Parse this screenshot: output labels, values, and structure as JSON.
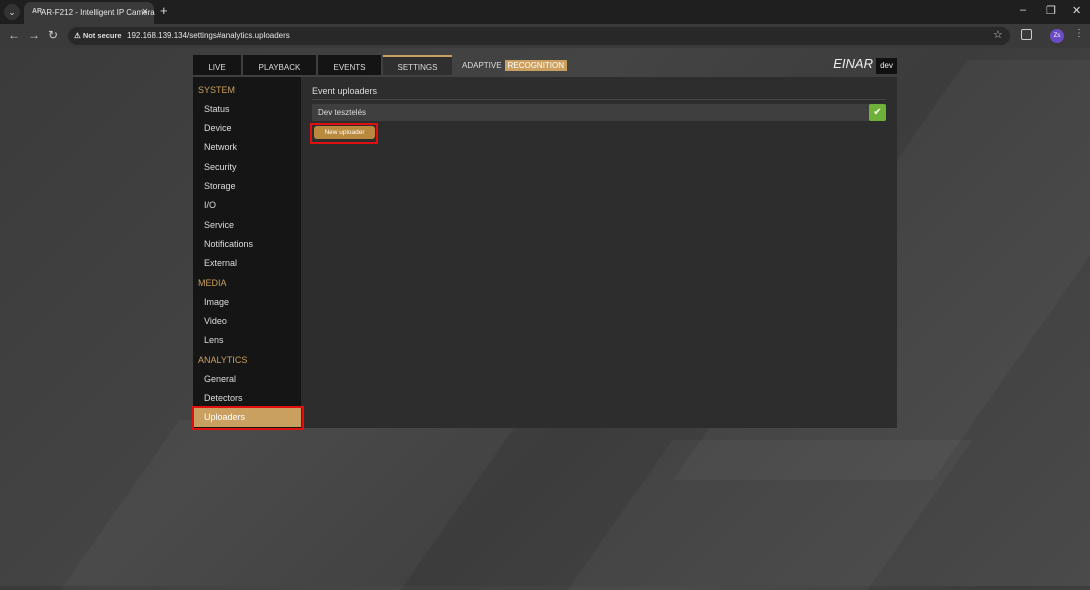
{
  "browser": {
    "tab_title": "AR-F212 - Intelligent IP Camera",
    "tab_favicon": "AR",
    "security_label": "Not secure",
    "url": "192.168.139.134/settings#analytics.uploaders",
    "profile_initials": "Zs"
  },
  "app": {
    "nav": {
      "live": "LIVE",
      "playback": "PLAYBACK",
      "events": "EVENTS",
      "settings": "SETTINGS",
      "adaptive": "ADAPTIVE",
      "recognition": "RECOGNITION"
    },
    "brand": "EINAR",
    "user": "dev",
    "accent_color": "#c9a060",
    "sidebar": {
      "system_header": "SYSTEM",
      "system_items": [
        "Status",
        "Device",
        "Network",
        "Security",
        "Storage",
        "I/O",
        "Service",
        "Notifications",
        "External"
      ],
      "media_header": "MEDIA",
      "media_items": [
        "Image",
        "Video",
        "Lens"
      ],
      "analytics_header": "ANALYTICS",
      "analytics_items": [
        "General",
        "Detectors",
        "Uploaders"
      ],
      "active_item": "Uploaders"
    },
    "content": {
      "title": "Event uploaders",
      "uploaders": [
        {
          "name": "Dev tesztelés",
          "enabled": true
        }
      ],
      "new_button": "New uploader"
    }
  }
}
